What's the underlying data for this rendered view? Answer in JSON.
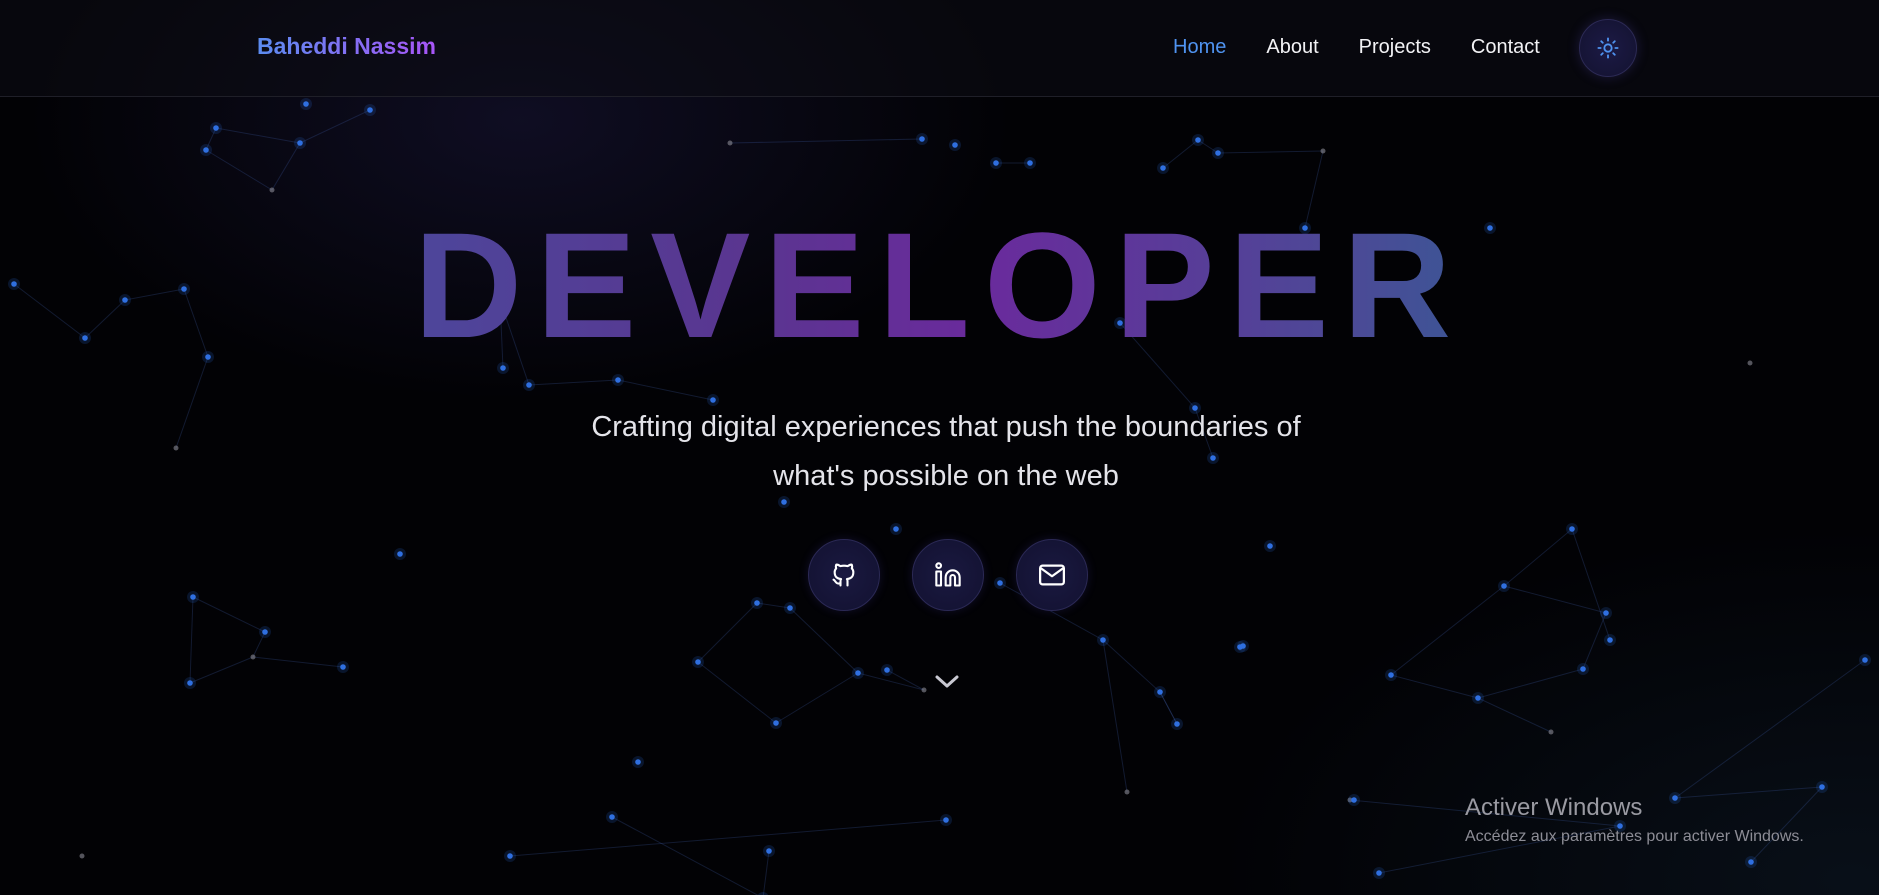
{
  "brand": {
    "name": "Baheddi Nassim"
  },
  "nav": {
    "items": [
      {
        "label": "Home",
        "active": true
      },
      {
        "label": "About",
        "active": false
      },
      {
        "label": "Projects",
        "active": false
      },
      {
        "label": "Contact",
        "active": false
      }
    ],
    "theme_toggle_icon": "sun-icon"
  },
  "hero": {
    "title": "DEVELOPER",
    "subtitle_line1": "Crafting digital experiences that push the boundaries of",
    "subtitle_line2": "what's possible on the web"
  },
  "socials": [
    {
      "icon": "github-icon"
    },
    {
      "icon": "linkedin-icon"
    },
    {
      "icon": "mail-icon"
    }
  ],
  "scroll_icon": "chevron-down-icon",
  "watermark": {
    "title": "Activer Windows",
    "subtitle": "Accédez aux paramètres pour activer Windows."
  },
  "colors": {
    "accent": "#4f93f0",
    "brand_gradient_start": "#5b8cf0",
    "brand_gradient_end": "#a855f7",
    "title_gradient": [
      "#3d5ba8",
      "#6a2a9c",
      "#057e92"
    ],
    "particle": "#2f6fe0",
    "background": "#020205"
  }
}
